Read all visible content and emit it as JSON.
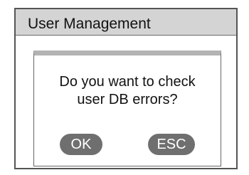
{
  "window": {
    "title": "User Management"
  },
  "dialog": {
    "message_line1": "Do you want to check",
    "message_line2": "user DB errors?",
    "ok_label": "OK",
    "esc_label": "ESC"
  },
  "colors": {
    "title_bar_bg": "#d4d4d4",
    "button_bg": "#6f6f6f",
    "dialog_top_strip": "#b3b3b3"
  }
}
